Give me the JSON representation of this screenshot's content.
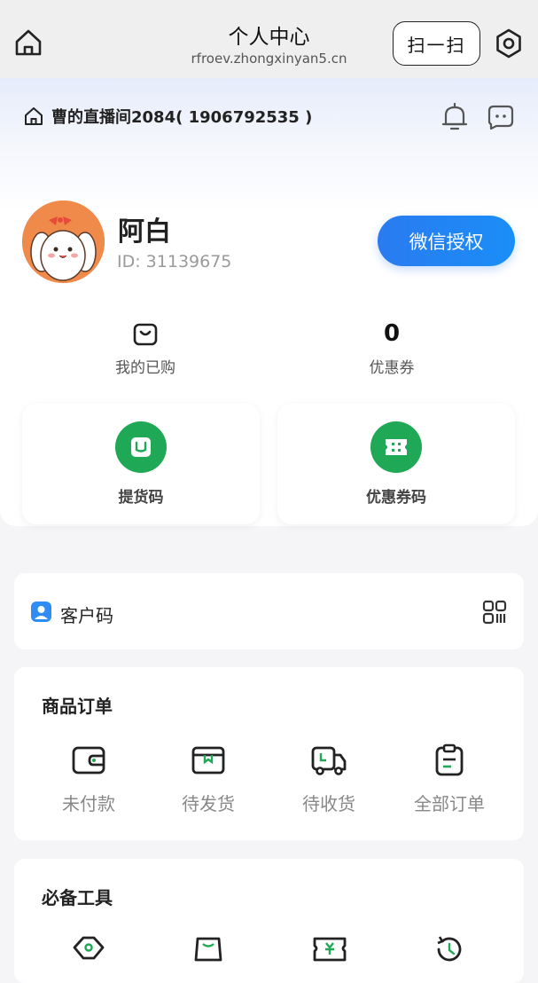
{
  "topbar": {
    "title": "个人中心",
    "domain": "rfroev.zhongxinyan5.cn",
    "scan_label": "扫一扫"
  },
  "header": {
    "live_room": "曹的直播间2084( 1906792535 )"
  },
  "profile": {
    "name": "阿白",
    "id": "ID: 31139675",
    "wechat_button": "微信授权"
  },
  "stats": [
    {
      "label": "我的已购",
      "icon": "shopping-bag-icon"
    },
    {
      "value": "0",
      "label": "优惠券"
    }
  ],
  "cards": [
    {
      "label": "提货码",
      "icon": "pickup-code-icon"
    },
    {
      "label": "优惠券码",
      "icon": "coupon-code-icon"
    }
  ],
  "customer_code": {
    "label": "客户码",
    "icon": "qr-code-icon"
  },
  "orders": {
    "title": "商品订单",
    "items": [
      {
        "label": "未付款",
        "icon": "wallet-icon"
      },
      {
        "label": "待发货",
        "icon": "package-box-icon"
      },
      {
        "label": "待收货",
        "icon": "delivery-truck-icon"
      },
      {
        "label": "全部订单",
        "icon": "clipboard-icon"
      }
    ]
  },
  "tools": {
    "title": "必备工具"
  },
  "colors": {
    "accent_blue": "#1a8ef7",
    "accent_green": "#1fa855",
    "background": "#f5f5f7"
  }
}
